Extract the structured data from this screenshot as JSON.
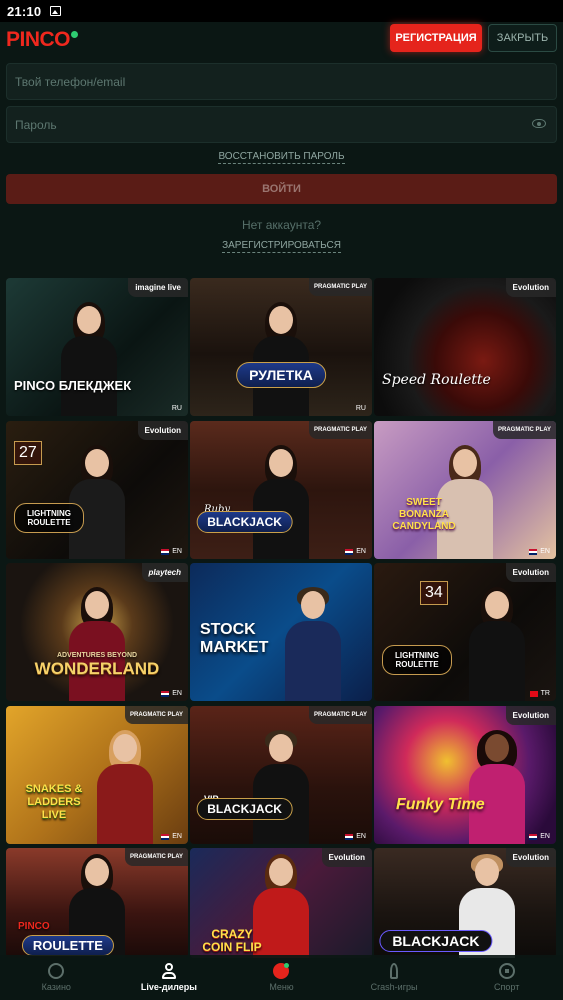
{
  "status_bar": {
    "time": "21:10"
  },
  "header": {
    "logo": "PINCO",
    "register_label": "РЕГИСТРАЦИЯ",
    "close_label": "ЗАКРЫТЬ"
  },
  "form": {
    "login_placeholder": "Твой телефон/email",
    "password_placeholder": "Пароль",
    "restore_password": "ВОССТАНОВИТЬ ПАРОЛЬ",
    "login_button": "ВОЙТИ",
    "no_account": "Нет аккаунта?",
    "register_link": "ЗАРЕГИСТРИРОВАТЬСЯ"
  },
  "games": [
    {
      "title": "PINCO БЛЕКДЖЕК",
      "provider": "imagine live",
      "lang": "RU"
    },
    {
      "title": "РУЛЕТКА",
      "provider": "PRAGMATIC PLAY",
      "lang": "RU"
    },
    {
      "title": "Speed Roulette",
      "provider": "Evolution",
      "lang": ""
    },
    {
      "title": "LIGHTNING ROULETTE",
      "provider": "Evolution",
      "lang": "EN",
      "number": "27"
    },
    {
      "title": "BLACKJACK",
      "provider": "PRAGMATIC PLAY",
      "lang": "EN",
      "subtitle": "Ruby"
    },
    {
      "title": "SWEET BONANZA CANDYLAND",
      "provider": "PRAGMATIC PLAY",
      "lang": "EN"
    },
    {
      "title": "WONDERLAND",
      "provider": "playtech",
      "lang": "EN",
      "subtitle": "ADVENTURES BEYOND"
    },
    {
      "title": "STOCK MARKET",
      "provider": "",
      "lang": ""
    },
    {
      "title": "LIGHTNING ROULETTE",
      "provider": "Evolution",
      "lang": "TR",
      "number": "34"
    },
    {
      "title": "SNAKES & LADDERS LIVE",
      "provider": "PRAGMATIC PLAY",
      "lang": "EN"
    },
    {
      "title": "BLACKJACK",
      "provider": "PRAGMATIC PLAY",
      "lang": "EN",
      "subtitle": "VIP"
    },
    {
      "title": "Funky Time",
      "provider": "Evolution",
      "lang": "EN"
    },
    {
      "title": "ROULETTE",
      "provider": "PRAGMATIC PLAY",
      "lang": "",
      "subtitle": "PINCO"
    },
    {
      "title": "CRAZY COIN FLIP",
      "provider": "Evolution",
      "lang": ""
    },
    {
      "title": "BLACKJACK",
      "provider": "Evolution",
      "lang": ""
    }
  ],
  "bottom_nav": [
    {
      "label": "Казино",
      "icon": "casino-icon",
      "active": false
    },
    {
      "label": "Live-дилеры",
      "icon": "live-dealer-icon",
      "active": true
    },
    {
      "label": "Меню",
      "icon": "menu-icon",
      "active": false
    },
    {
      "label": "Crash-игры",
      "icon": "rocket-icon",
      "active": false
    },
    {
      "label": "Спорт",
      "icon": "sport-icon",
      "active": false
    }
  ],
  "colors": {
    "accent": "#e5241c",
    "background": "#0b1714",
    "brand_green": "#2ecc71"
  }
}
